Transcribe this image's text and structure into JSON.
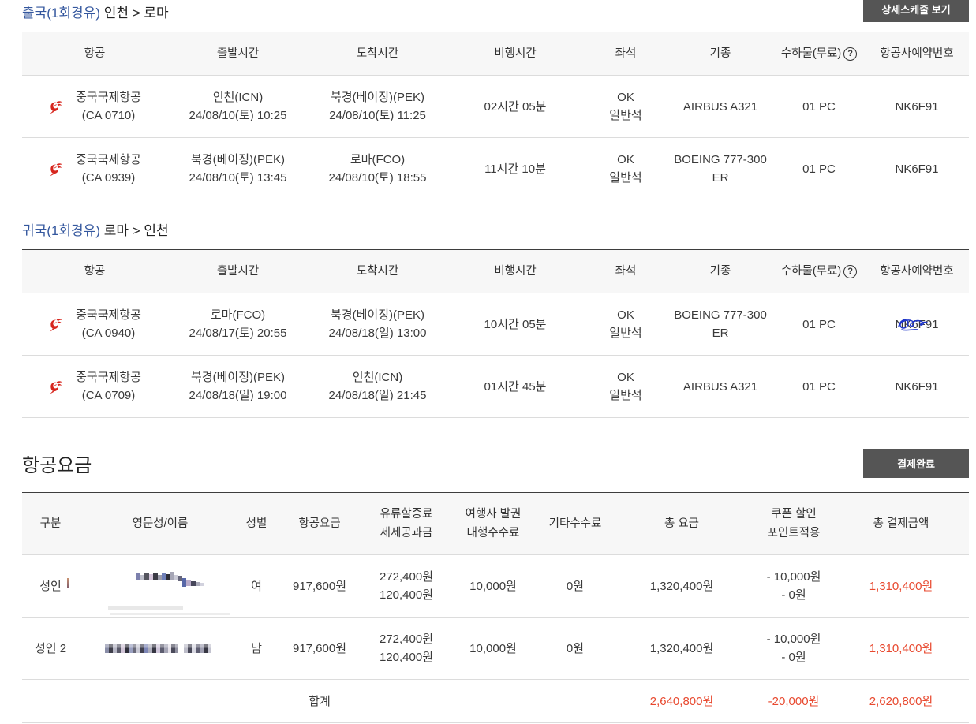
{
  "outbound": {
    "label": "출국(1회경유)",
    "route": "인천 > 로마",
    "detail_button": "상세스케줄 보기",
    "rows": [
      {
        "airline": "중국국제항공",
        "flight": "(CA 0710)",
        "dep_place": "인천(ICN)",
        "dep_time": "24/08/10(토) 10:25",
        "arr_place": "북경(베이징)(PEK)",
        "arr_time": "24/08/10(토) 11:25",
        "duration": "02시간 05분",
        "seat_status": "OK",
        "seat_class": "일반석",
        "aircraft": [
          "AIRBUS A321"
        ],
        "baggage": "01 PC",
        "pnr": "NK6F91"
      },
      {
        "airline": "중국국제항공",
        "flight": "(CA 0939)",
        "dep_place": "북경(베이징)(PEK)",
        "dep_time": "24/08/10(토) 13:45",
        "arr_place": "로마(FCO)",
        "arr_time": "24/08/10(토) 18:55",
        "duration": "11시간 10분",
        "seat_status": "OK",
        "seat_class": "일반석",
        "aircraft": [
          "BOEING 777-300",
          "ER"
        ],
        "baggage": "01 PC",
        "pnr": "NK6F91"
      }
    ]
  },
  "inbound": {
    "label": "귀국(1회경유)",
    "route": "로마 > 인천",
    "rows": [
      {
        "airline": "중국국제항공",
        "flight": "(CA 0940)",
        "dep_place": "로마(FCO)",
        "dep_time": "24/08/17(토) 20:55",
        "arr_place": "북경(베이징)(PEK)",
        "arr_time": "24/08/18(일) 13:00",
        "duration": "10시간 05분",
        "seat_status": "OK",
        "seat_class": "일반석",
        "aircraft": [
          "BOEING 777-300",
          "ER"
        ],
        "baggage": "01 PC",
        "pnr": "NK6F91"
      },
      {
        "airline": "중국국제항공",
        "flight": "(CA 0709)",
        "dep_place": "북경(베이징)(PEK)",
        "dep_time": "24/08/18(일) 19:00",
        "arr_place": "인천(ICN)",
        "arr_time": "24/08/18(일) 21:45",
        "duration": "01시간 45분",
        "seat_status": "OK",
        "seat_class": "일반석",
        "aircraft": [
          "AIRBUS A321"
        ],
        "baggage": "01 PC",
        "pnr": "NK6F91"
      }
    ]
  },
  "flight_columns": [
    "항공",
    "출발시간",
    "도착시간",
    "비행시간",
    "좌석",
    "기종",
    "수하물(무료)",
    "항공사예약번호"
  ],
  "fare": {
    "title": "항공요금",
    "status_button": "결제완료",
    "columns": [
      [
        "구분"
      ],
      [
        "영문성/이름"
      ],
      [
        "성별"
      ],
      [
        "항공요금"
      ],
      [
        "유류할증료",
        "제세공과금"
      ],
      [
        "여행사 발권",
        "대행수수료"
      ],
      [
        "기타수수료"
      ],
      [
        "총 요금"
      ],
      [
        "쿠폰 할인",
        "포인트적용"
      ],
      [
        "총 결제금액"
      ]
    ],
    "rows": [
      {
        "type": "성인",
        "gender": "여",
        "base_fare": "917,600원",
        "surcharges": [
          "272,400원",
          "120,400원"
        ],
        "agency_fee": "10,000원",
        "other_fee": "0원",
        "total": "1,320,400원",
        "discounts": [
          "- 10,000원",
          "- 0원"
        ],
        "paid": "1,310,400원"
      },
      {
        "type": "성인 2",
        "gender": "남",
        "base_fare": "917,600원",
        "surcharges": [
          "272,400원",
          "120,400원"
        ],
        "agency_fee": "10,000원",
        "other_fee": "0원",
        "total": "1,320,400원",
        "discounts": [
          "- 10,000원",
          "- 0원"
        ],
        "paid": "1,310,400원"
      }
    ],
    "summary": {
      "label": "합계",
      "total": "2,640,800원",
      "discount": "-20,000원",
      "paid": "2,620,800원"
    }
  },
  "colors": {
    "accent_blue": "#34579e",
    "button_bg": "#555555",
    "amount_red": "#e8492f",
    "logo_red": "#d7261e",
    "scribble_blue": "#1f36c9",
    "header_bg": "#f7f7f7"
  },
  "icons": {
    "airline_logo": "air-china-logo-icon",
    "baggage_help": "help-icon"
  }
}
